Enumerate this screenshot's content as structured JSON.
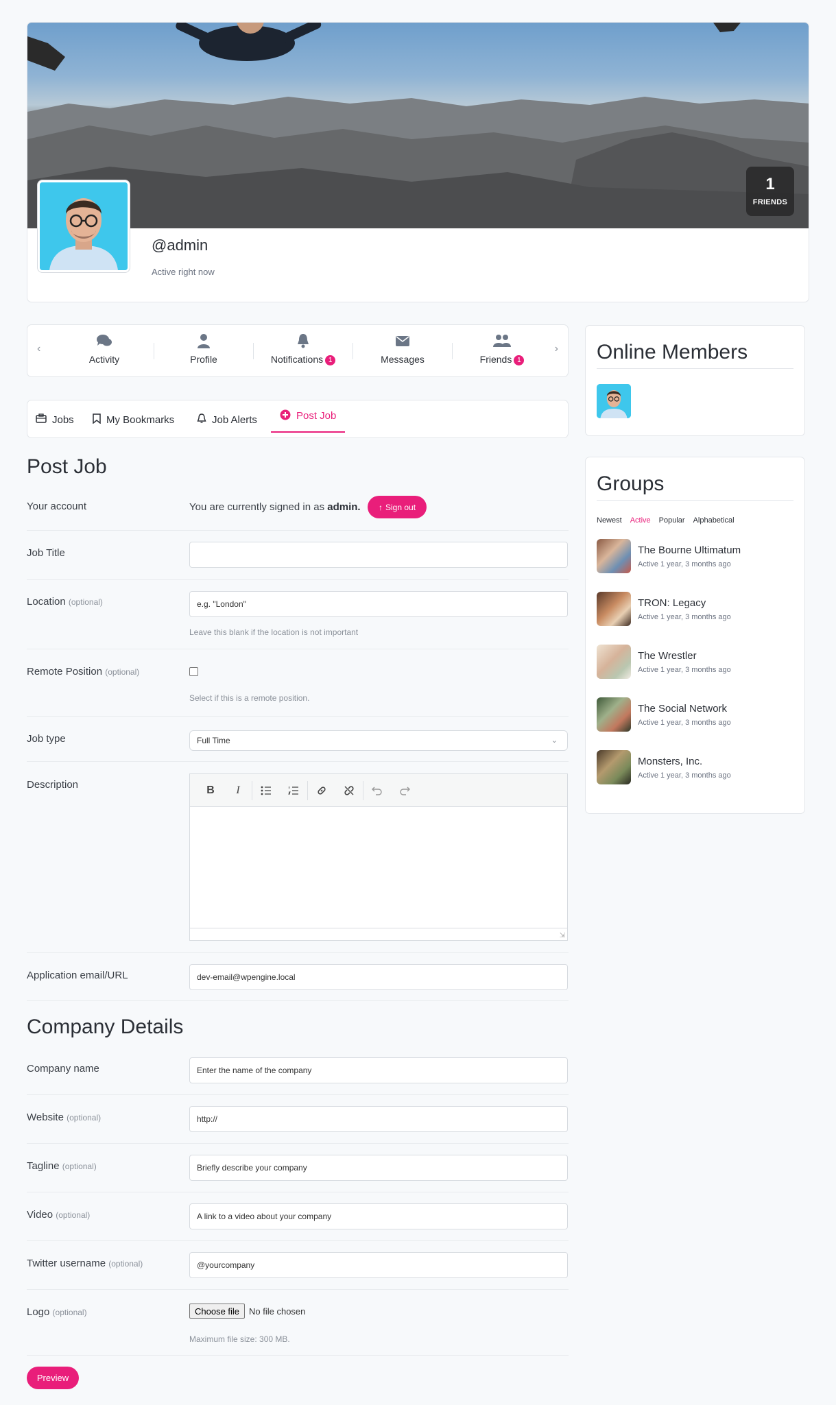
{
  "profile": {
    "handle": "@admin",
    "status": "Active right now",
    "friends_count": "1",
    "friends_label": "FRIENDS"
  },
  "nav": {
    "items": [
      {
        "label": "Activity",
        "icon": "comments-icon"
      },
      {
        "label": "Profile",
        "icon": "user-icon"
      },
      {
        "label": "Notifications",
        "icon": "bell-icon",
        "badge": "1"
      },
      {
        "label": "Messages",
        "icon": "envelope-icon"
      },
      {
        "label": "Friends",
        "icon": "users-icon",
        "badge": "1"
      }
    ]
  },
  "subtabs": [
    {
      "label": "Jobs",
      "icon": "briefcase-icon"
    },
    {
      "label": "My Bookmarks",
      "icon": "bookmark-icon"
    },
    {
      "label": "Job Alerts",
      "icon": "bell-icon"
    },
    {
      "label": "Post Job",
      "icon": "plus-circle-icon",
      "active": true
    }
  ],
  "form": {
    "title": "Post Job",
    "account_label": "Your account",
    "signed_in_prefix": "You are currently signed in as",
    "signed_in_user": "admin.",
    "sign_out": "Sign out",
    "job_title_label": "Job Title",
    "location_label": "Location",
    "location_placeholder": "e.g. \"London\"",
    "location_hint": "Leave this blank if the location is not important",
    "remote_label": "Remote Position",
    "remote_hint": "Select if this is a remote position.",
    "job_type_label": "Job type",
    "job_type_value": "Full Time",
    "description_label": "Description",
    "application_label": "Application email/URL",
    "application_value": "dev-email@wpengine.local",
    "optional": "(optional)"
  },
  "company": {
    "title": "Company Details",
    "name_label": "Company name",
    "name_placeholder": "Enter the name of the company",
    "website_label": "Website",
    "website_placeholder": "http://",
    "tagline_label": "Tagline",
    "tagline_placeholder": "Briefly describe your company",
    "video_label": "Video",
    "video_placeholder": "A link to a video about your company",
    "twitter_label": "Twitter username",
    "twitter_placeholder": "@yourcompany",
    "logo_label": "Logo",
    "choose_file": "Choose file",
    "no_file": "No file chosen",
    "max_size": "Maximum file size: 300 MB.",
    "preview": "Preview"
  },
  "sidebar": {
    "online_title": "Online Members",
    "groups_title": "Groups",
    "filters": [
      "Newest",
      "Active",
      "Popular",
      "Alphabetical"
    ],
    "active_filter": "Active",
    "groups": [
      {
        "name": "The Bourne Ultimatum",
        "meta": "Active 1 year, 3 months ago"
      },
      {
        "name": "TRON: Legacy",
        "meta": "Active 1 year, 3 months ago"
      },
      {
        "name": "The Wrestler",
        "meta": "Active 1 year, 3 months ago"
      },
      {
        "name": "The Social Network",
        "meta": "Active 1 year, 3 months ago"
      },
      {
        "name": "Monsters, Inc.",
        "meta": "Active 1 year, 3 months ago"
      }
    ]
  },
  "colors": {
    "accent": "#e91e7a",
    "text": "#2b2f36",
    "muted": "#8a9099"
  }
}
